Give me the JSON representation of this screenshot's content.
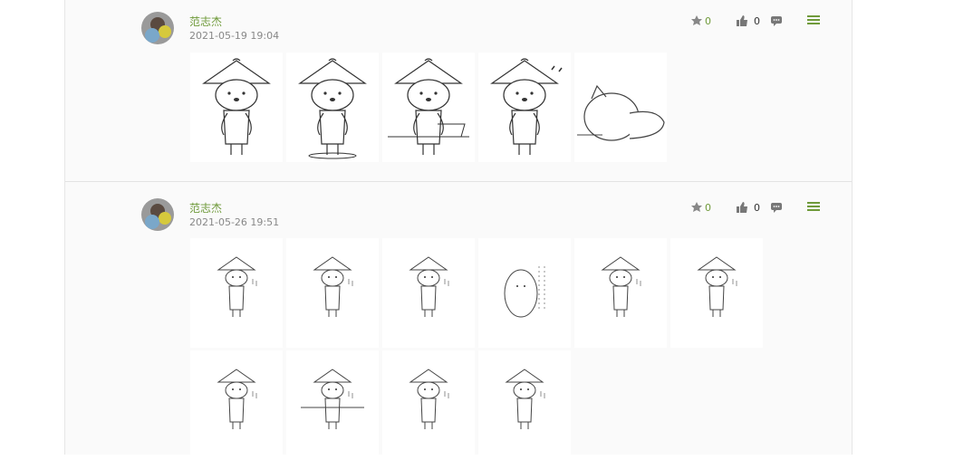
{
  "posts": [
    {
      "author": "范志杰",
      "timestamp": "2021-05-19 19:04",
      "gift_count": "0",
      "like_count": "0",
      "images": [
        {
          "icon": "shiba-waving-sticker"
        },
        {
          "icon": "shiba-skateboard-sticker"
        },
        {
          "icon": "shiba-laptop-sticker"
        },
        {
          "icon": "shiba-guitar-sticker"
        },
        {
          "icon": "shiba-sleeping-sticker"
        }
      ]
    },
    {
      "author": "范志杰",
      "timestamp": "2021-05-26 19:51",
      "gift_count": "0",
      "like_count": "0",
      "images": [
        {
          "icon": "shiba-sticker"
        },
        {
          "icon": "shiba-sticker"
        },
        {
          "icon": "shiba-sticker"
        },
        {
          "icon": "shiba-blob-sticker"
        },
        {
          "icon": "shiba-sticker"
        },
        {
          "icon": "shiba-sticker"
        },
        {
          "icon": "shiba-sticker"
        },
        {
          "icon": "shiba-table-sticker"
        },
        {
          "icon": "shiba-sticker"
        },
        {
          "icon": "shiba-sticker"
        }
      ]
    }
  ],
  "colors": {
    "accent": "#6f9a3a",
    "muted": "#888888"
  }
}
